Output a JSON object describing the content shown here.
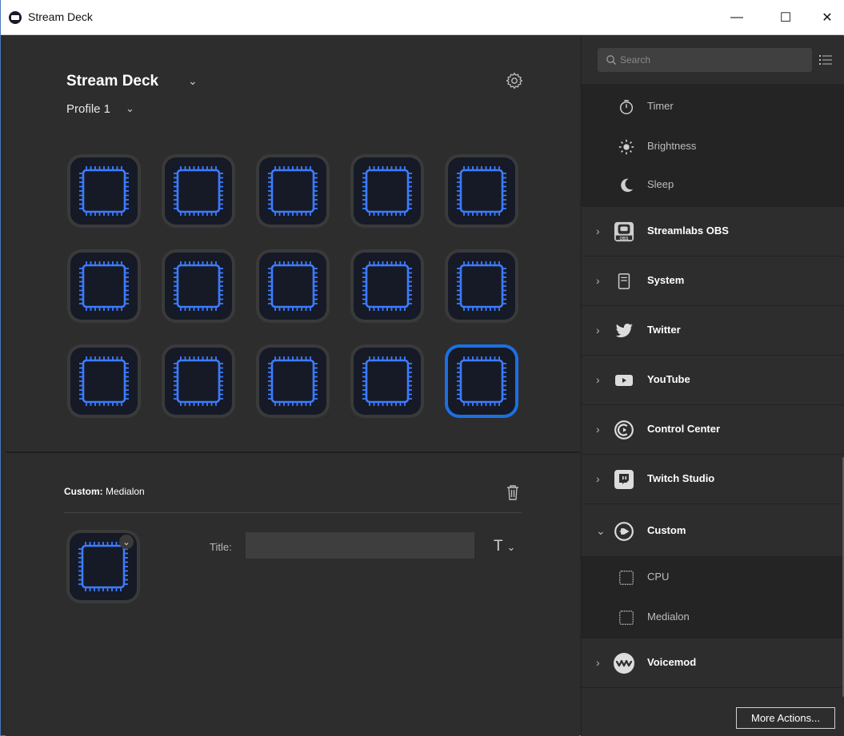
{
  "window": {
    "title": "Stream Deck",
    "minimize": "—",
    "maximize": "☐",
    "close": "✕"
  },
  "deck": {
    "name": "Stream Deck",
    "profile": "Profile 1"
  },
  "keys": {
    "rows": 3,
    "cols": 5,
    "selected_index": 14
  },
  "properties": {
    "action_prefix": "Custom:",
    "action_name": "Medialon",
    "title_label": "Title:",
    "title_value": "",
    "text_format": "T"
  },
  "sidebar": {
    "search_placeholder": "Search",
    "sub_items_top": [
      {
        "label": "Timer",
        "icon": "timer-icon"
      },
      {
        "label": "Brightness",
        "icon": "brightness-icon"
      },
      {
        "label": "Sleep",
        "icon": "sleep-icon"
      }
    ],
    "categories": [
      {
        "label": "Streamlabs OBS",
        "icon": "streamlabs-obs-icon",
        "expanded": false
      },
      {
        "label": "System",
        "icon": "system-icon",
        "expanded": false
      },
      {
        "label": "Twitter",
        "icon": "twitter-icon",
        "expanded": false
      },
      {
        "label": "YouTube",
        "icon": "youtube-icon",
        "expanded": false
      },
      {
        "label": "Control Center",
        "icon": "control-center-icon",
        "expanded": false
      },
      {
        "label": "Twitch Studio",
        "icon": "twitch-studio-icon",
        "expanded": false
      },
      {
        "label": "Custom",
        "icon": "custom-icon",
        "expanded": true
      },
      {
        "label": "Voicemod",
        "icon": "voicemod-icon",
        "expanded": false
      }
    ],
    "custom_items": [
      {
        "label": "CPU",
        "icon": "cpu-chip-icon"
      },
      {
        "label": "Medialon",
        "icon": "cpu-chip-icon"
      }
    ],
    "more_actions": "More Actions..."
  },
  "colors": {
    "accent": "#1d6fe0",
    "chip_blue": "#3d7bff",
    "background": "#2d2d2d"
  }
}
